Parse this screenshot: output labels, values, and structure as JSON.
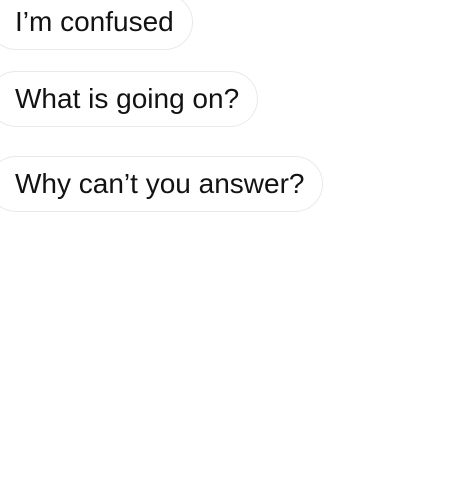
{
  "suggestions": [
    {
      "label": "I’m confused"
    },
    {
      "label": "What is going on?"
    },
    {
      "label": "Why can’t you answer?"
    }
  ]
}
